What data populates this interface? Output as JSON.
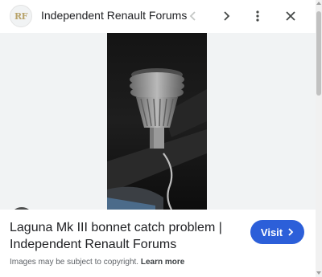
{
  "header": {
    "logo_text": "RF",
    "site_name": "Independent Renault Forums",
    "icons": {
      "prev": "chevron-left-icon",
      "next": "chevron-right-icon",
      "more": "more-vert-icon",
      "close": "close-icon"
    }
  },
  "image": {
    "lens_icon": "google-lens-icon"
  },
  "result": {
    "title": "Laguna Mk III bonnet catch problem | Independent Renault Forums",
    "visit_label": "Visit",
    "copyright_text": "Images may be subject to copyright.",
    "learn_more_label": "Learn more"
  },
  "colors": {
    "visit_bg": "#2c5fd9",
    "image_bg": "#f1f3f4",
    "logo_text": "#b8a36a"
  }
}
